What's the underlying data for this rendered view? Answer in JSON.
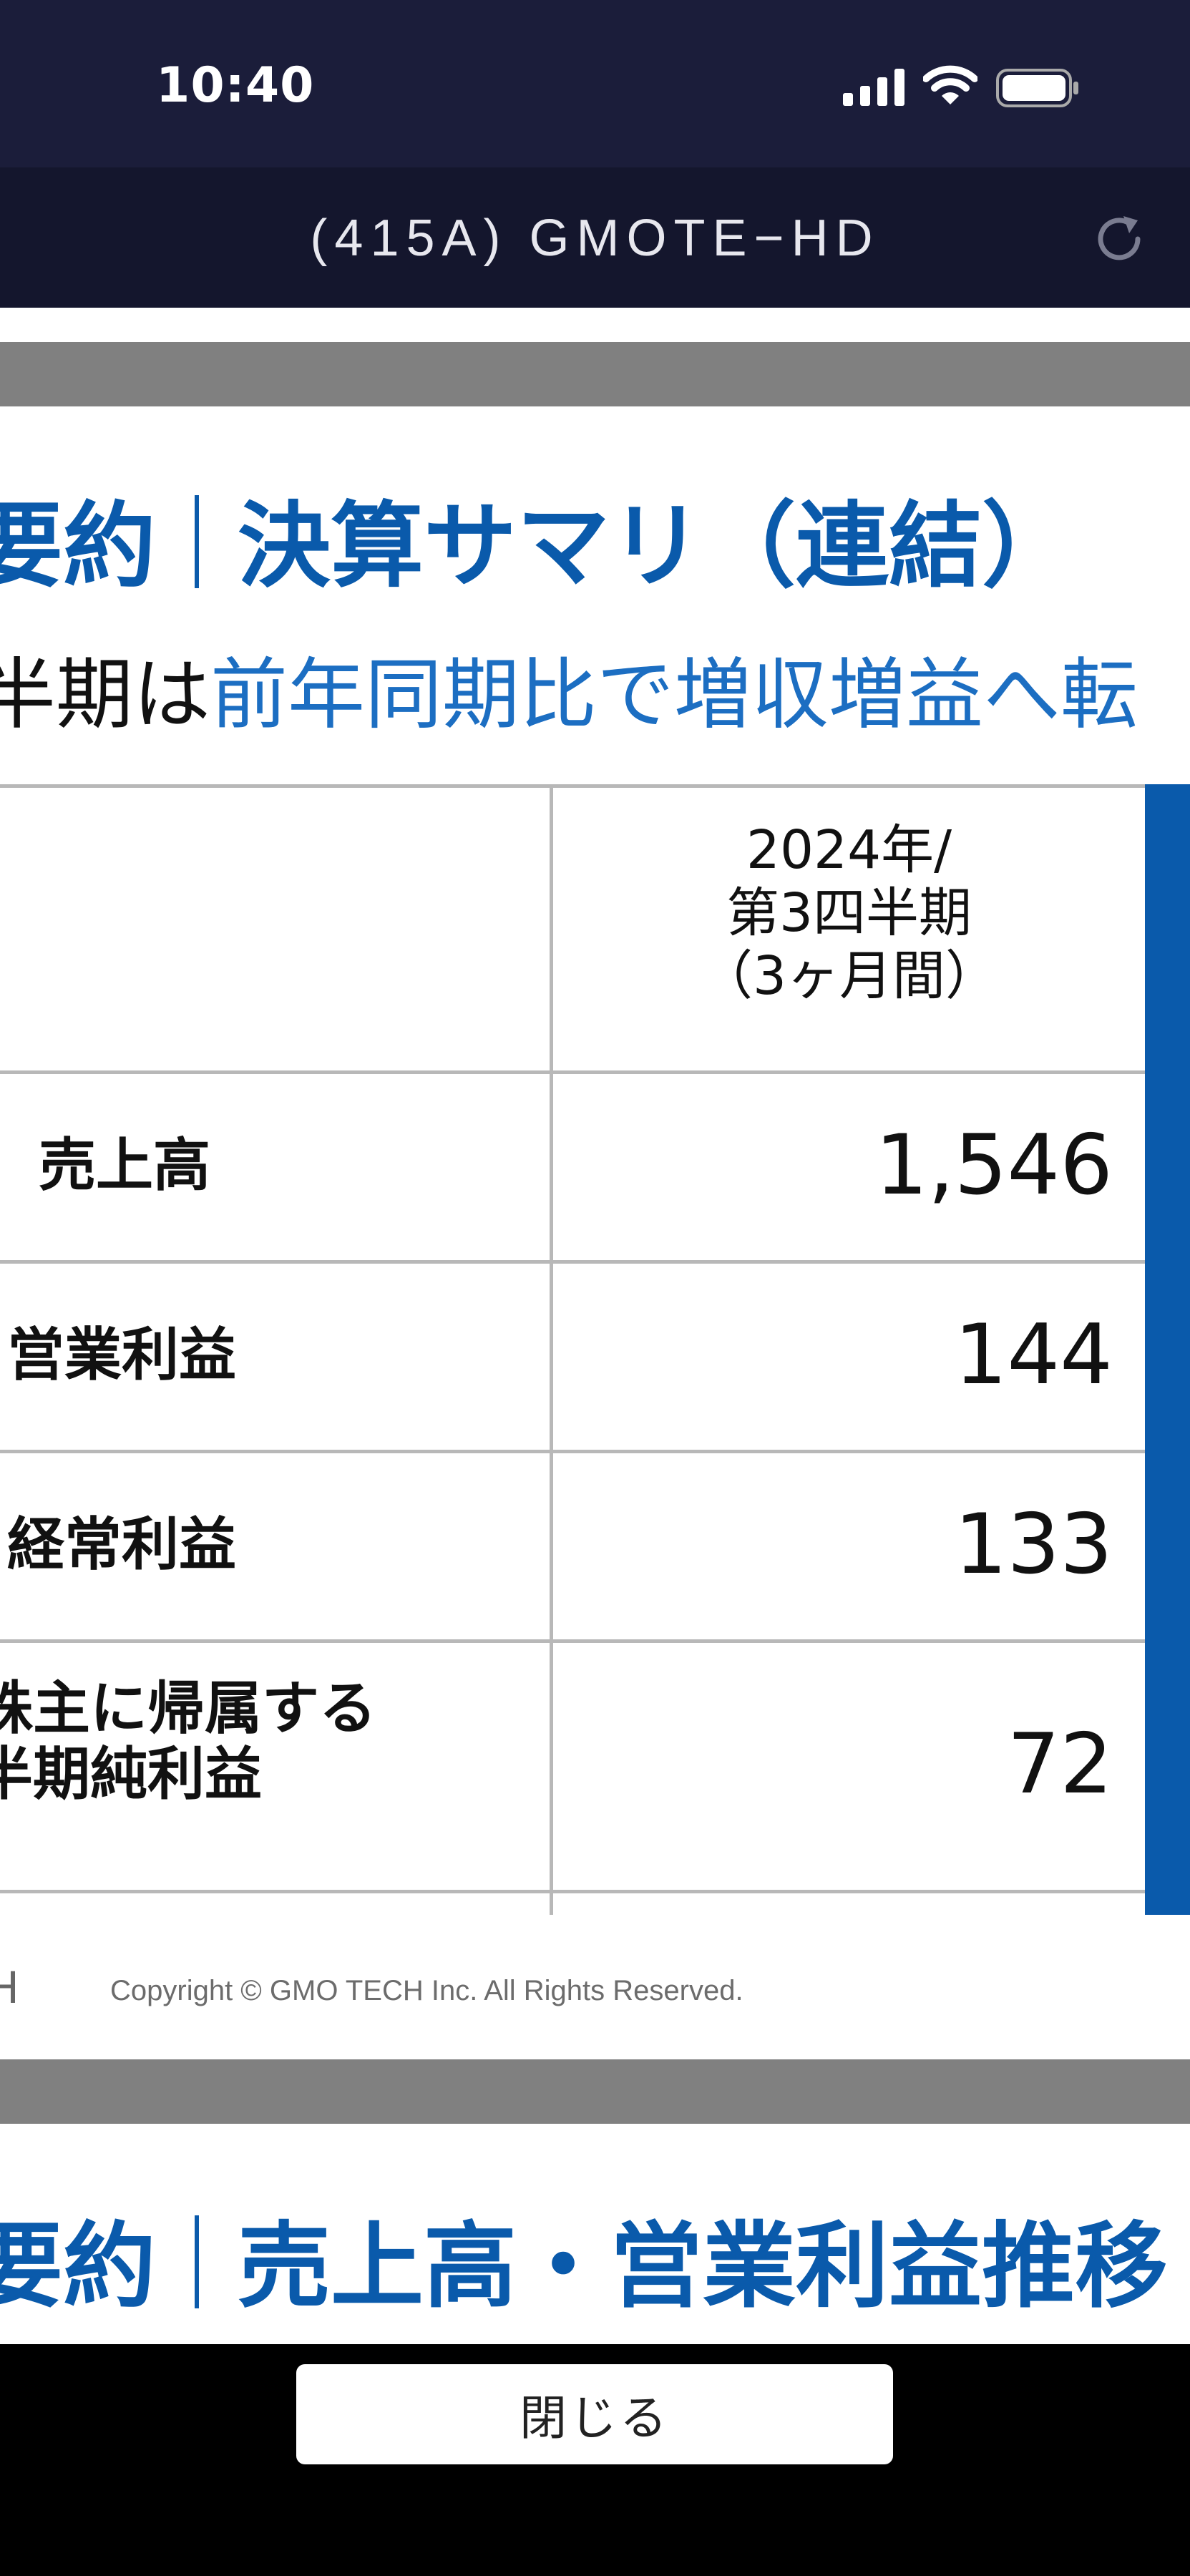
{
  "status_bar": {
    "time": "10:40",
    "icons": [
      "cellular-signal-icon",
      "wifi-icon",
      "battery-icon"
    ]
  },
  "nav": {
    "title": "(415A) GMOTE−HD",
    "reload_icon": "reload-icon"
  },
  "slide1": {
    "title_left": "要約",
    "title_right": "決算サマリ（連結）",
    "subheading_prefix": "半期は",
    "subheading_highlight": "前年同期比で増収増益へ転",
    "table": {
      "column_header": [
        "2024年/",
        "第3四半期",
        "（3ヶ月間）"
      ],
      "rows": [
        {
          "label": "売上高",
          "value": "1,546"
        },
        {
          "label": "営業利益",
          "value": "144"
        },
        {
          "label": "経常利益",
          "value": "133"
        },
        {
          "label_line1": "株主に帰属する",
          "label_line2": "半期純利益",
          "value": "72"
        }
      ]
    },
    "footer_logo_text": "H",
    "copyright": "Copyright © GMO TECH Inc. All Rights Reserved."
  },
  "slide2": {
    "title_left": "要約",
    "title_right": "売上高・営業利益推移"
  },
  "bottom": {
    "close_label": "閉じる"
  },
  "colors": {
    "accent_blue": "#0a5aab",
    "header_bg": "#14162d",
    "band_gray": "#808080"
  }
}
